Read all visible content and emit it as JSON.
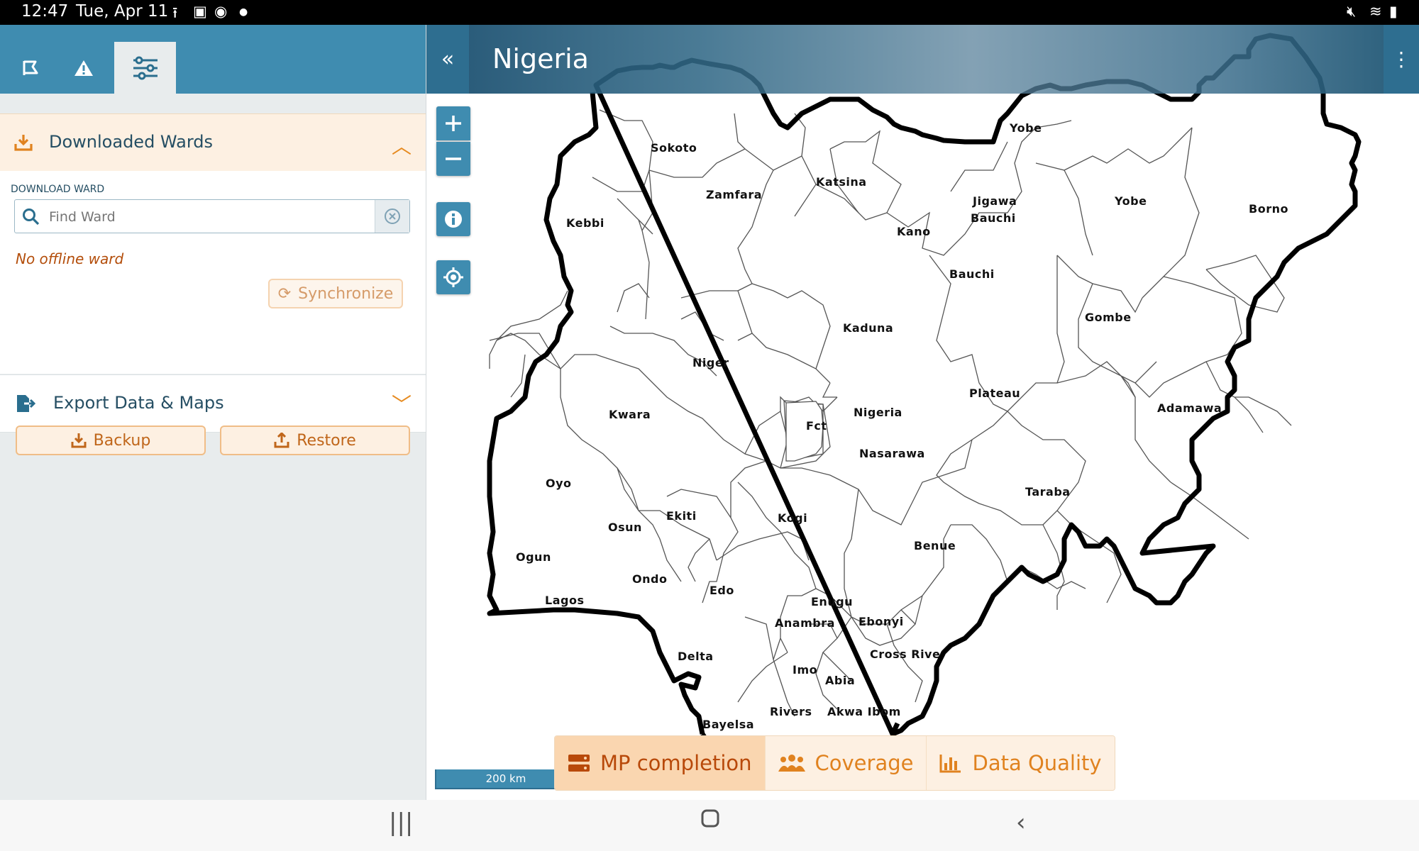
{
  "status_bar": {
    "time": "12:47",
    "date": "Tue, Apr 11",
    "left_icons": [
      "upload-icon",
      "gallery-icon",
      "chrome-icon",
      "dot-icon"
    ],
    "right_icons": [
      "mute-icon",
      "wifi-icon",
      "battery-icon"
    ]
  },
  "sidebar": {
    "tabs": [
      {
        "name": "map-tab",
        "icon": "map-icon",
        "active": false
      },
      {
        "name": "alerts-tab",
        "icon": "warning-icon",
        "active": false
      },
      {
        "name": "settings-tab",
        "icon": "sliders-icon",
        "active": true
      }
    ],
    "downloaded_wards": {
      "title": "Downloaded Wards",
      "field_label": "DOWNLOAD WARD",
      "search_placeholder": "Find Ward",
      "empty_message": "No offline ward",
      "sync_label": "Synchronize"
    },
    "export": {
      "title": "Export Data & Maps"
    },
    "backup_label": "Backup",
    "restore_label": "Restore"
  },
  "map": {
    "title": "Nigeria",
    "collapse_icon": "double-chevron-left-icon",
    "menu_icon": "kebab-icon",
    "controls": [
      "zoom-in-icon",
      "zoom-out-icon",
      "info-icon",
      "locate-icon"
    ],
    "scale_label": "200 km",
    "states": [
      {
        "name": "Sokoto"
      },
      {
        "name": "Yobe"
      },
      {
        "name": "Katsina"
      },
      {
        "name": "Zamfara"
      },
      {
        "name": "Kebbi"
      },
      {
        "name": "Jigawa"
      },
      {
        "name": "Bauchi"
      },
      {
        "name": "Yobe"
      },
      {
        "name": "Borno"
      },
      {
        "name": "Kano"
      },
      {
        "name": "Bauchi"
      },
      {
        "name": "Gombe"
      },
      {
        "name": "Kaduna"
      },
      {
        "name": "Niger"
      },
      {
        "name": "Plateau"
      },
      {
        "name": "Adamawa"
      },
      {
        "name": "Nigeria"
      },
      {
        "name": "Kwara"
      },
      {
        "name": "Fct"
      },
      {
        "name": "Nasarawa"
      },
      {
        "name": "Oyo"
      },
      {
        "name": "Taraba"
      },
      {
        "name": "Ekiti"
      },
      {
        "name": "Osun"
      },
      {
        "name": "Kogi"
      },
      {
        "name": "Benue"
      },
      {
        "name": "Ogun"
      },
      {
        "name": "Ondo"
      },
      {
        "name": "Edo"
      },
      {
        "name": "Lagos"
      },
      {
        "name": "Enugu"
      },
      {
        "name": "Anambra"
      },
      {
        "name": "Ebonyi"
      },
      {
        "name": "Delta"
      },
      {
        "name": "Cross Rive"
      },
      {
        "name": "Imo"
      },
      {
        "name": "Abia"
      },
      {
        "name": "Rivers"
      },
      {
        "name": "Akwa Ibom"
      },
      {
        "name": "Bayelsa"
      }
    ],
    "bottom_tabs": [
      {
        "label": "MP completion",
        "icon": "server-icon",
        "active": true
      },
      {
        "label": "Coverage",
        "icon": "users-icon",
        "active": false
      },
      {
        "label": "Data Quality",
        "icon": "bar-chart-icon",
        "active": false
      }
    ]
  },
  "nav_bar": [
    "recents-icon",
    "home-icon",
    "back-icon"
  ],
  "colors": {
    "header_blue": "#3f8cb0",
    "accent_orange": "#e0821f",
    "sidebar_bg": "#e8eced"
  }
}
